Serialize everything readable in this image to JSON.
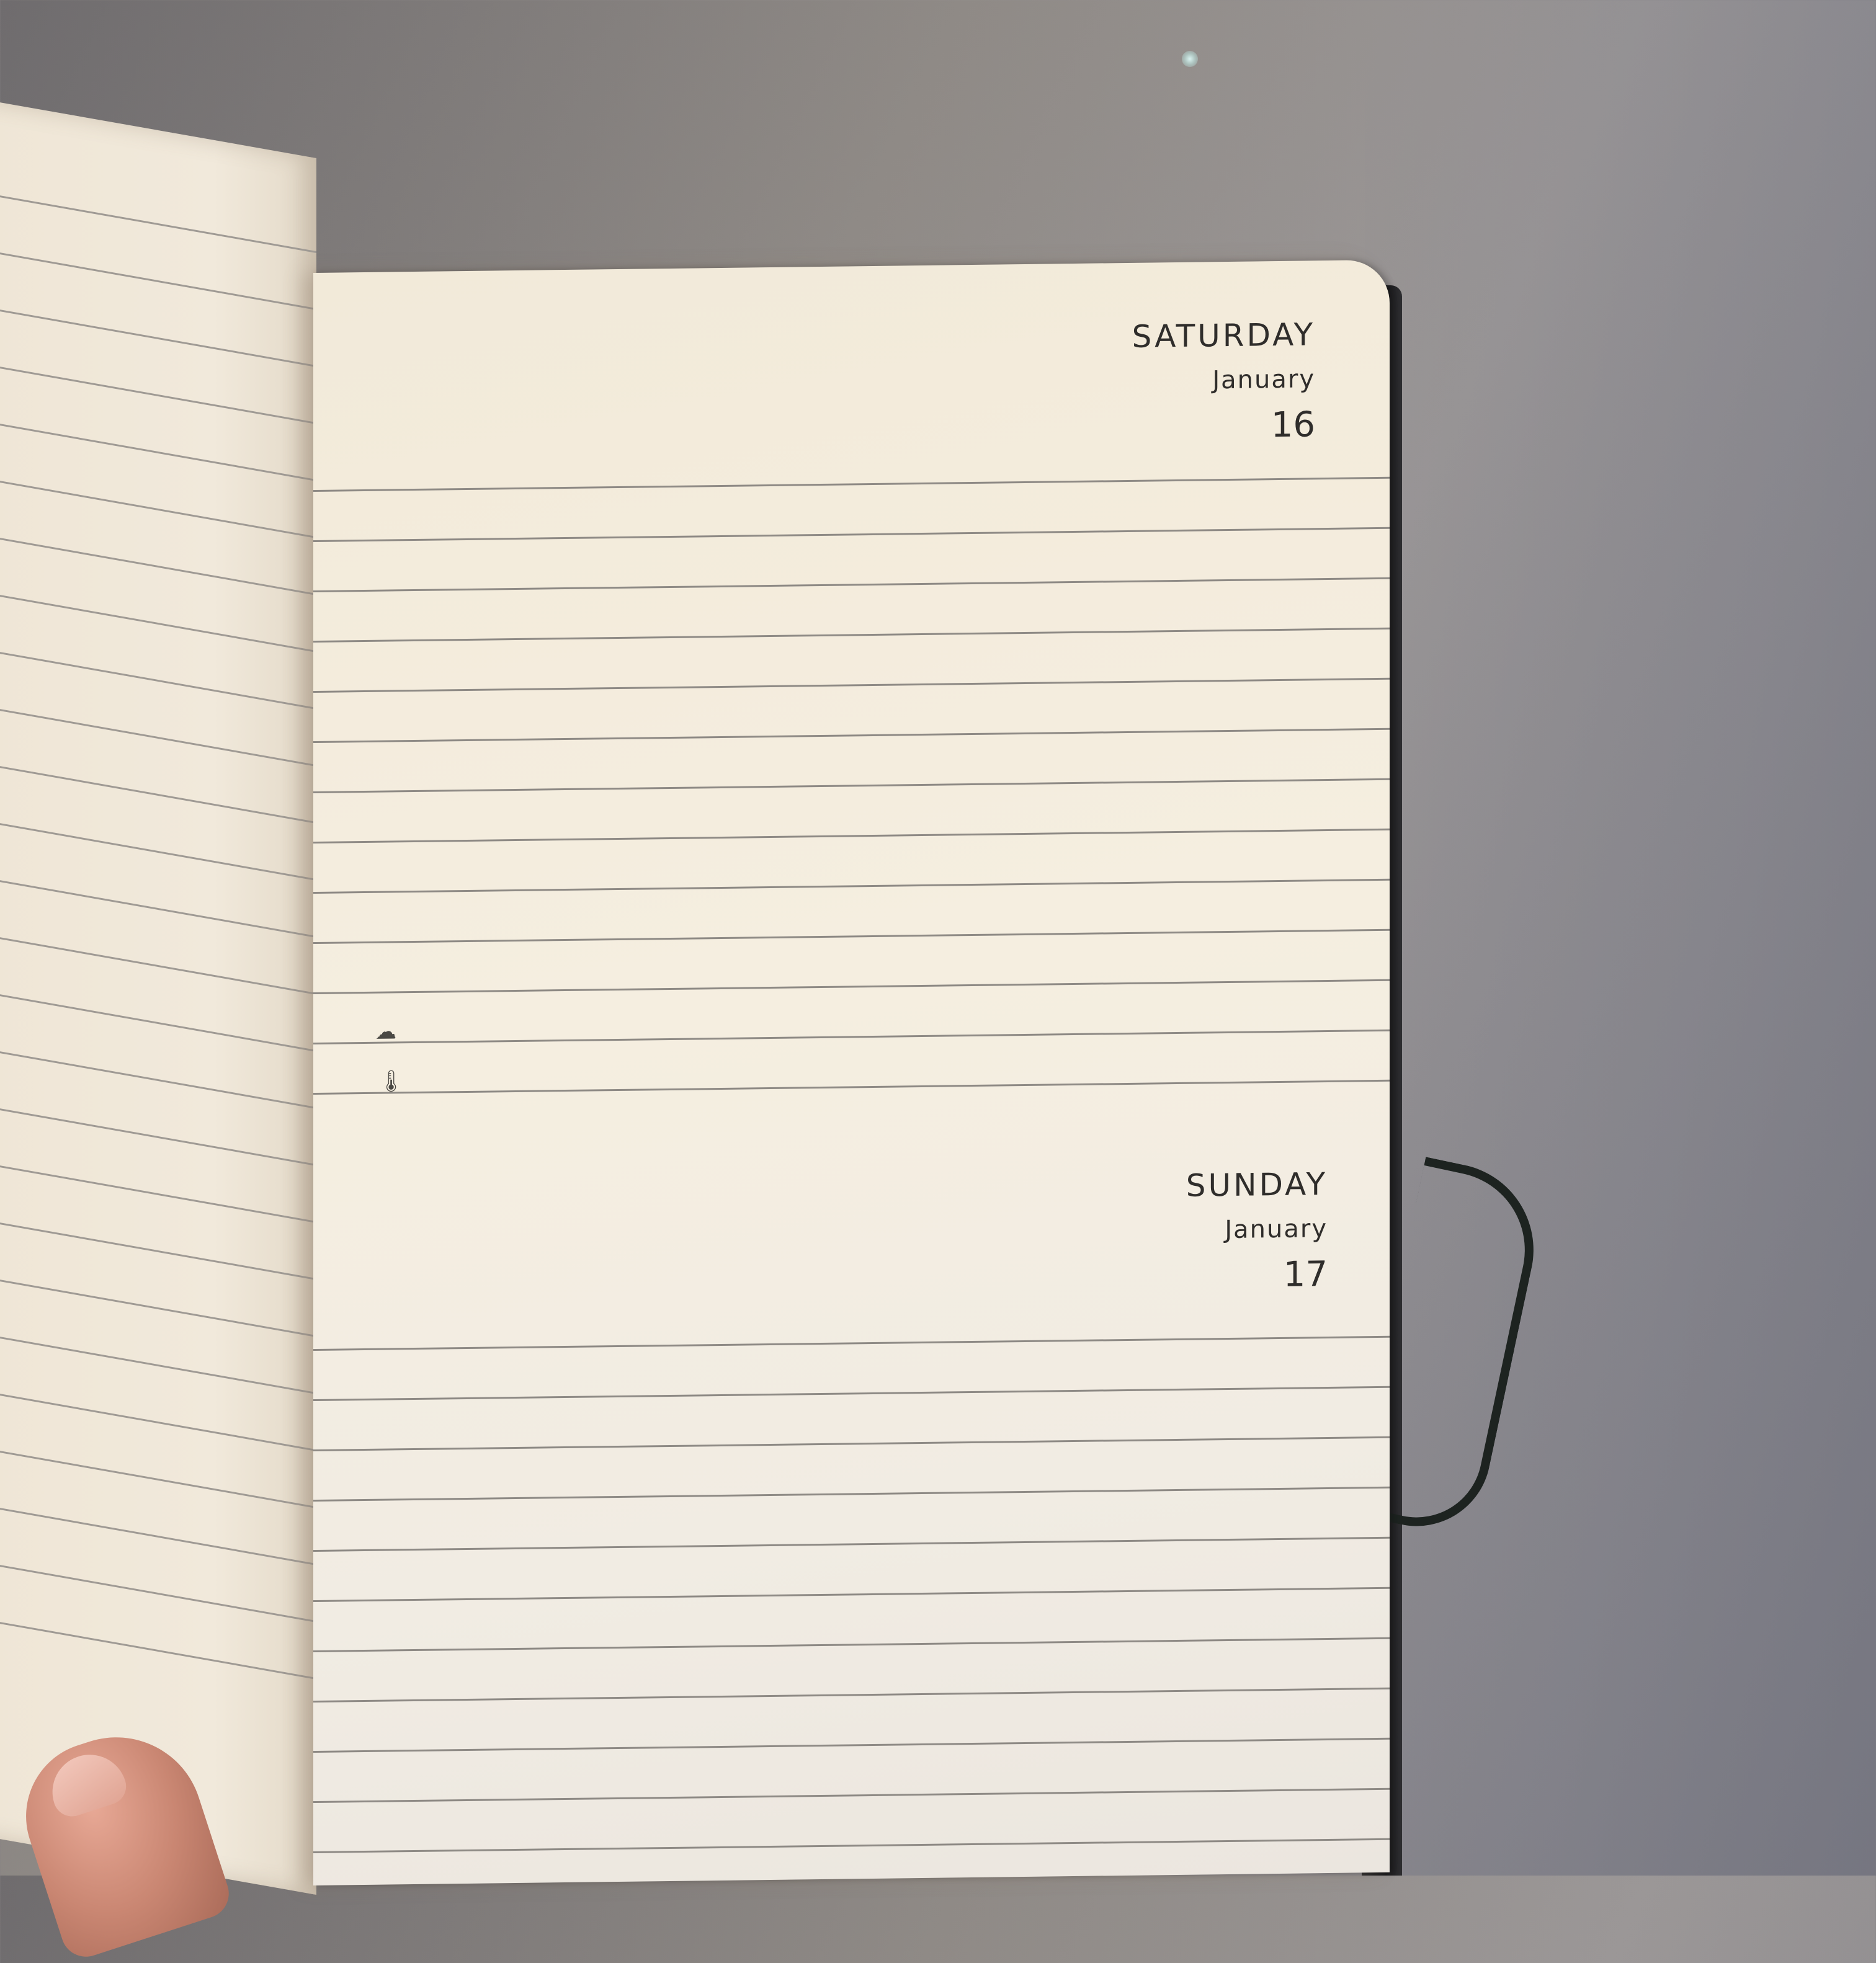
{
  "planner": {
    "day1": {
      "weekday": "SATURDAY",
      "month": "January",
      "day": "16"
    },
    "day2": {
      "weekday": "SUNDAY",
      "month": "January",
      "day": "17"
    }
  },
  "icons": [
    "weather-icon",
    "thermometer-icon"
  ],
  "colors": {
    "paper": "#f2ead9",
    "ink": "#2f2d2b",
    "rule": "#8e8a85",
    "cover": "#1b1b1d"
  }
}
